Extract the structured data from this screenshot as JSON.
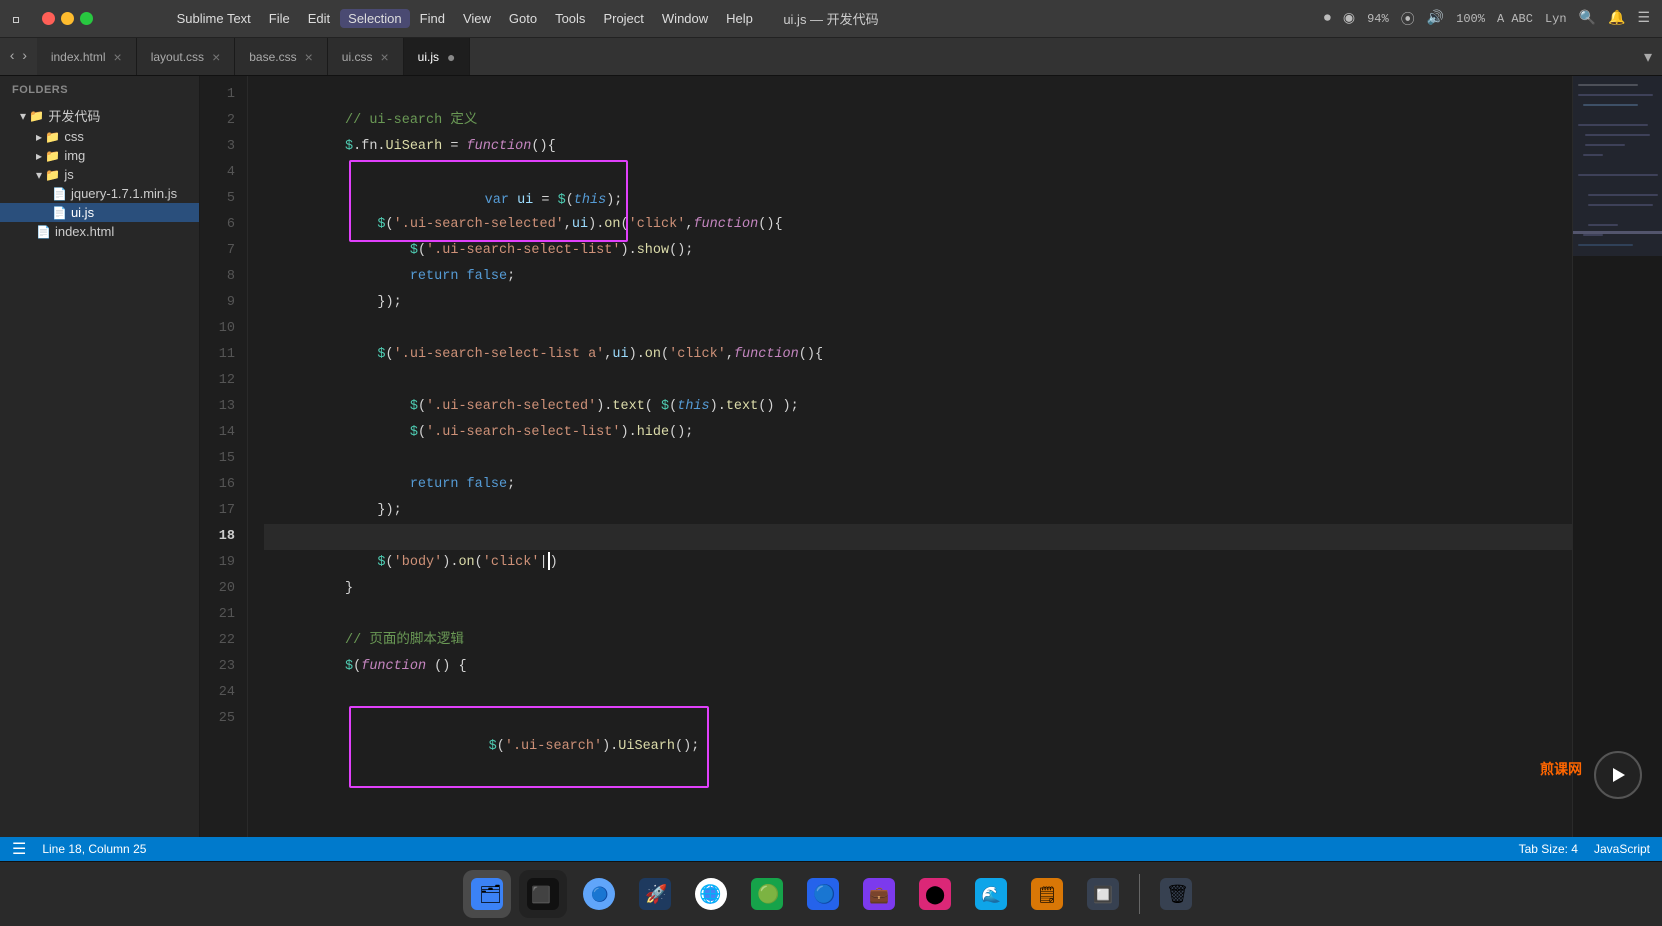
{
  "titlebar": {
    "title": "ui.js — 开发代码",
    "app_name": "Sublime Text"
  },
  "menubar": {
    "items": [
      {
        "label": "Sublime Text",
        "active": false
      },
      {
        "label": "File",
        "active": false
      },
      {
        "label": "Edit",
        "active": false
      },
      {
        "label": "Selection",
        "active": true
      },
      {
        "label": "Find",
        "active": false
      },
      {
        "label": "View",
        "active": false
      },
      {
        "label": "Goto",
        "active": false
      },
      {
        "label": "Tools",
        "active": false
      },
      {
        "label": "Project",
        "active": false
      },
      {
        "label": "Window",
        "active": false
      },
      {
        "label": "Help",
        "active": false
      }
    ]
  },
  "tabs": [
    {
      "label": "index.html",
      "active": false,
      "dirty": false,
      "closable": true
    },
    {
      "label": "layout.css",
      "active": false,
      "dirty": false,
      "closable": true
    },
    {
      "label": "base.css",
      "active": false,
      "dirty": false,
      "closable": true
    },
    {
      "label": "ui.css",
      "active": false,
      "dirty": false,
      "closable": true
    },
    {
      "label": "ui.js",
      "active": true,
      "dirty": true,
      "closable": false
    }
  ],
  "sidebar": {
    "header": "FOLDERS",
    "items": [
      {
        "label": "开发代码",
        "indent": 1,
        "type": "folder",
        "expanded": true
      },
      {
        "label": "css",
        "indent": 2,
        "type": "folder",
        "expanded": false
      },
      {
        "label": "img",
        "indent": 2,
        "type": "folder",
        "expanded": false
      },
      {
        "label": "js",
        "indent": 2,
        "type": "folder",
        "expanded": true
      },
      {
        "label": "jquery-1.7.1.min.js",
        "indent": 3,
        "type": "file",
        "expanded": false
      },
      {
        "label": "ui.js",
        "indent": 3,
        "type": "file",
        "expanded": false,
        "selected": true
      },
      {
        "label": "index.html",
        "indent": 2,
        "type": "file",
        "expanded": false
      }
    ]
  },
  "code": {
    "lines": [
      {
        "num": 1,
        "content": "// ui-search 定义"
      },
      {
        "num": 2,
        "content": "$.fn.UiSearh = function(){"
      },
      {
        "num": 3,
        "content": "    var ui = $(this);",
        "highlight_box": true
      },
      {
        "num": 4,
        "content": ""
      },
      {
        "num": 5,
        "content": "    $('.ui-search-selected',ui).on('click',function(){"
      },
      {
        "num": 6,
        "content": "        $('.ui-search-select-list').show();"
      },
      {
        "num": 7,
        "content": "        return false;"
      },
      {
        "num": 8,
        "content": "    });"
      },
      {
        "num": 9,
        "content": ""
      },
      {
        "num": 10,
        "content": "    $('.ui-search-select-list a',ui).on('click',function(){"
      },
      {
        "num": 11,
        "content": ""
      },
      {
        "num": 12,
        "content": "        $('.ui-search-selected').text( $(this).text() );"
      },
      {
        "num": 13,
        "content": "        $('.ui-search-select-list').hide();"
      },
      {
        "num": 14,
        "content": ""
      },
      {
        "num": 15,
        "content": "        return false;"
      },
      {
        "num": 16,
        "content": "    });"
      },
      {
        "num": 17,
        "content": ""
      },
      {
        "num": 18,
        "content": "    $('body').on('click'|)",
        "cursor": true
      },
      {
        "num": 19,
        "content": "}"
      },
      {
        "num": 20,
        "content": ""
      },
      {
        "num": 21,
        "content": "// 页面的脚本逻辑"
      },
      {
        "num": 22,
        "content": "$(function () {"
      },
      {
        "num": 23,
        "content": ""
      },
      {
        "num": 24,
        "content": "    $('.ui-search').UiSearh();",
        "highlight_box2": true
      },
      {
        "num": 25,
        "content": ""
      }
    ]
  },
  "statusbar": {
    "left": "Line 18, Column 25",
    "tab_size": "Tab Size: 4",
    "language": "JavaScript"
  },
  "dock_items": [
    {
      "name": "finder",
      "emoji": "🗂"
    },
    {
      "name": "terminal",
      "emoji": "⬛"
    },
    {
      "name": "finder2",
      "emoji": "🔵"
    },
    {
      "name": "launchpad",
      "emoji": "🚀"
    },
    {
      "name": "chrome",
      "emoji": "🌐"
    },
    {
      "name": "app6",
      "emoji": "🟢"
    },
    {
      "name": "app7",
      "emoji": "🔵"
    },
    {
      "name": "app8",
      "emoji": "💼"
    },
    {
      "name": "app9",
      "emoji": "⬤"
    },
    {
      "name": "app10",
      "emoji": "🌊"
    },
    {
      "name": "app11",
      "emoji": "🗒"
    },
    {
      "name": "app12",
      "emoji": "🔲"
    },
    {
      "name": "trash",
      "emoji": "🗑"
    }
  ],
  "watermark": "煎课网",
  "colors": {
    "bg": "#1e1e1e",
    "sidebar_bg": "#272727",
    "tab_active": "#1e1e1e",
    "tab_inactive": "#2d2d2d",
    "statusbar": "#007acc",
    "selection_border": "#e040fb",
    "comment": "#6a9955",
    "keyword": "#569cd6",
    "string": "#ce9178",
    "function_color": "#dcdcaa",
    "variable": "#9cdcfe"
  }
}
